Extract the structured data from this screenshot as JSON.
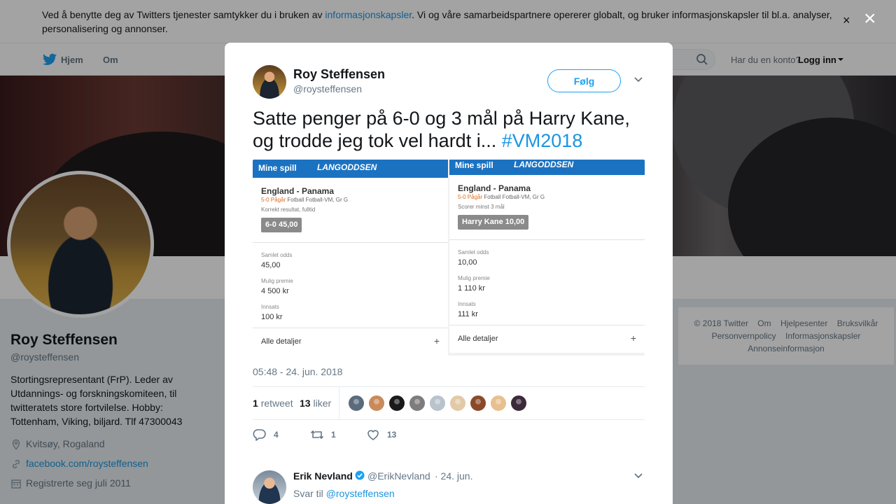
{
  "cookie_banner": {
    "text_before": "Ved å benytte deg av Twitters tjenester samtykker du i bruken av ",
    "link": "informasjonskapsler",
    "text_after": ". Vi og våre samarbeidspartnere opererer globalt, og bruker informasjonskapsler til bl.a. analyser, personalisering og annonser.",
    "close": "×"
  },
  "nav": {
    "home": "Hjem",
    "about": "Om",
    "login_question": "Har du en konto?",
    "login_link": "Logg inn"
  },
  "profile": {
    "name": "Roy Steffensen",
    "handle": "@roysteffensen",
    "bio": "Stortingsrepresentant (FrP). Leder av Utdannings- og forskningskomiteen, til twitteratets store fortvilelse. Hobby: Tottenham, Viking, biljard. Tlf 47300043",
    "location": "Kvitsøy, Rogaland",
    "website": "facebook.com/roysteffensen",
    "joined": "Registrerte seg juli 2011"
  },
  "footer": {
    "line1": [
      "© 2018 Twitter",
      "Om",
      "Hjelpesenter",
      "Bruksvilkår"
    ],
    "line2": [
      "Personvernpolicy",
      "Informasjonskapsler"
    ],
    "line3": [
      "Annonseinformasjon"
    ]
  },
  "overlay": {
    "close": "×"
  },
  "tweet": {
    "author_name": "Roy Steffensen",
    "author_handle": "@roysteffensen",
    "follow_label": "Følg",
    "text": "Satte penger på 6-0 og 3 mål på Harry Kane, og trodde jeg tok vel hardt i... ",
    "hashtag": "#VM2018",
    "timestamp": "05:48 - 24. jun. 2018",
    "retweets": "1",
    "retweets_label": "retweet",
    "likes": "13",
    "likes_label": "liker",
    "reply_count": "4",
    "retweet_count": "1",
    "like_count": "13",
    "liker_colors": [
      "#5a6b7c",
      "#c98a5a",
      "#1a1a1a",
      "#7d7d7d",
      "#b9c3cc",
      "#e2c9a8",
      "#8a4a2a",
      "#e8c090",
      "#3a2a3a"
    ]
  },
  "bets": [
    {
      "back": "Mine spill",
      "brand": "LANGODDSEN",
      "match": "England - Panama",
      "live_score": "5-0 Pågår",
      "league": "Fotball Fotball-VM, Gr G",
      "market": "Korrekt resultat, fulltid",
      "pick": "6-0 45,00",
      "odds_label": "Samlet odds",
      "odds": "45,00",
      "payout_label": "Mulig premie",
      "payout": "4 500 kr",
      "stake_label": "Innsats",
      "stake": "100 kr",
      "details": "Alle detaljer",
      "plus": "+"
    },
    {
      "back": "Mine spill",
      "brand": "LANGODDSEN",
      "match": "England - Panama",
      "live_score": "5-0 Pågår",
      "league": "Fotball Fotball-VM, Gr G",
      "market": "Scorer minst 3 mål",
      "pick": "Harry Kane 10,00",
      "odds_label": "Samlet odds",
      "odds": "10,00",
      "payout_label": "Mulig premie",
      "payout": "1 110 kr",
      "stake_label": "Innsats",
      "stake": "111 kr",
      "details": "Alle detaljer",
      "plus": "+"
    }
  ],
  "reply": {
    "name": "Erik Nevland",
    "handle": "@ErikNevland",
    "date": "· 24. jun.",
    "reply_to_label": "Svar til ",
    "reply_to_handle": "@roysteffensen"
  }
}
